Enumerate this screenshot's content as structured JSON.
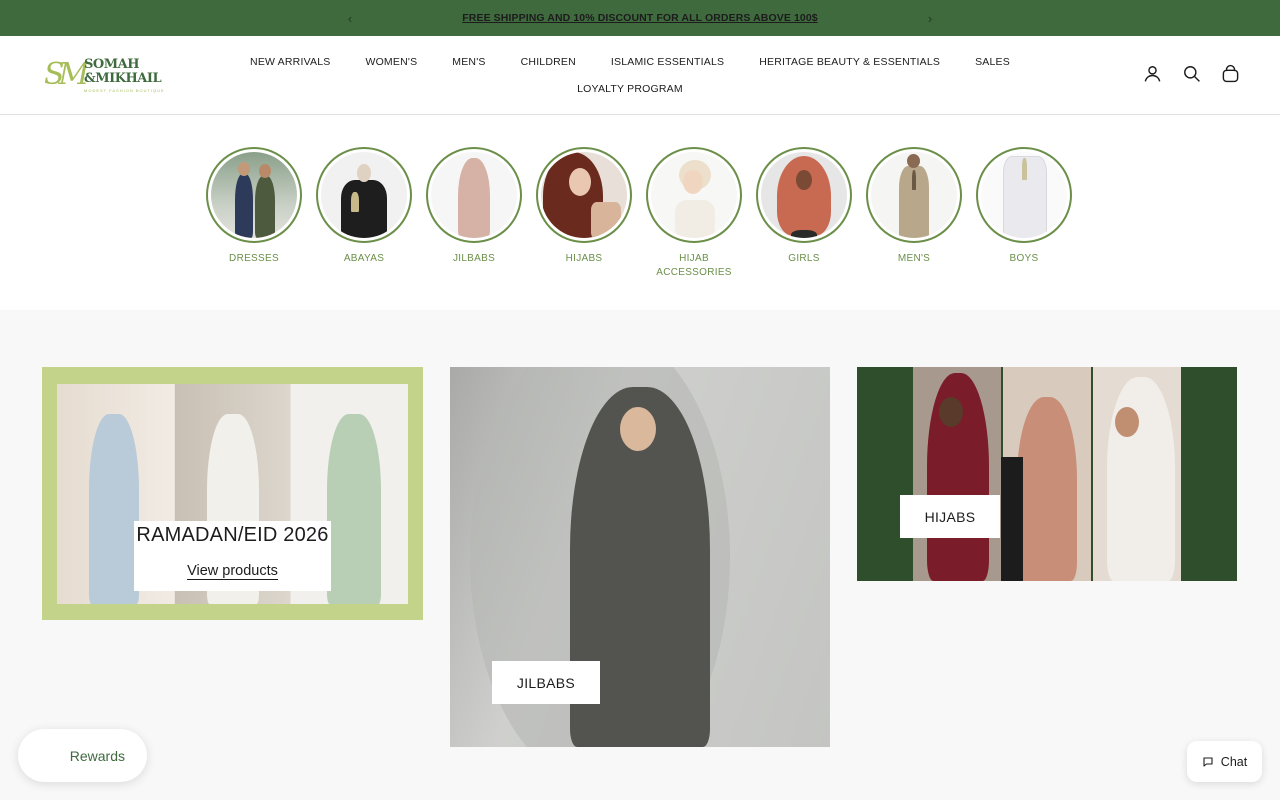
{
  "announcement": {
    "text": "FREE SHIPPING AND 10% DISCOUNT FOR ALL ORDERS ABOVE 100$",
    "prev_glyph": "‹",
    "next_glyph": "›"
  },
  "brand": {
    "monogram": "SM",
    "name_line1": "SOMAH",
    "name_line2": "&MIKHAIL",
    "tagline": "MODEST FASHION BOUTIQUE",
    "colors": {
      "dark_green": "#3f6a3e",
      "light_green": "#a6bd5a",
      "accent": "#6b8f49"
    }
  },
  "nav": {
    "row1": [
      "NEW ARRIVALS",
      "WOMEN'S",
      "MEN'S",
      "CHILDREN",
      "ISLAMIC ESSENTIALS",
      "HERITAGE BEAUTY & ESSENTIALS",
      "SALES"
    ],
    "row2": [
      "LOYALTY PROGRAM"
    ]
  },
  "header_icons": [
    "account-icon",
    "search-icon",
    "cart-icon"
  ],
  "categories": [
    {
      "label": "DRESSES"
    },
    {
      "label": "ABAYAS"
    },
    {
      "label": "JILBABS"
    },
    {
      "label": "HIJABS"
    },
    {
      "label": "HIJAB ACCESSORIES"
    },
    {
      "label": "GIRLS"
    },
    {
      "label": "MEN'S"
    },
    {
      "label": "BOYS"
    }
  ],
  "collections": {
    "ramadan": {
      "title": "RAMADAN/EID 2026",
      "link": "View products"
    },
    "jilbabs": {
      "button": "JILBABS"
    },
    "hijabs": {
      "button": "HIJABS"
    }
  },
  "rewards": {
    "label": "Rewards"
  },
  "chat": {
    "label": "Chat"
  }
}
